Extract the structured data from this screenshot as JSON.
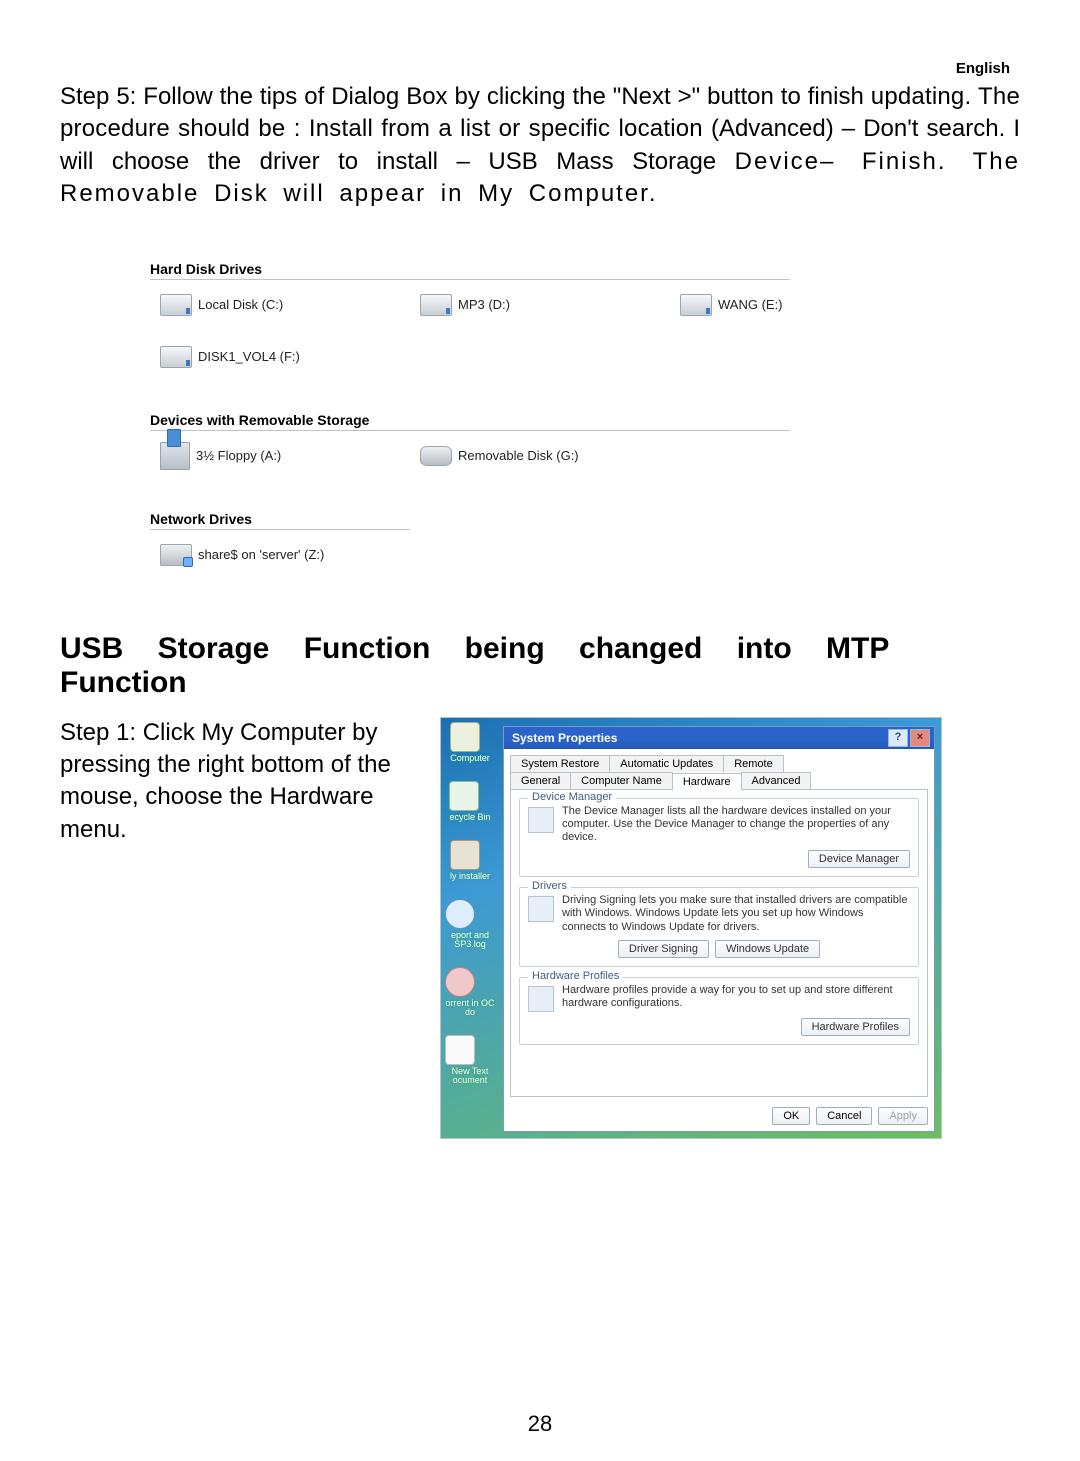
{
  "header": {
    "language": "English"
  },
  "paragraph_step5_lines": [
    "Step 5: Follow the tips of Dialog Box by clicking the \"Next >\" button to finish",
    "updating. The procedure should be : Install from a list or specific location",
    "(Advanced) – Don't search. I will choose the driver to install – USB Mass Storage",
    "Device– Finish. The Removable Disk will appear in My Computer."
  ],
  "my_computer": {
    "sections": {
      "hdd": {
        "title": "Hard Disk Drives",
        "items": [
          "Local Disk (C:)",
          "MP3 (D:)",
          "WANG (E:)",
          "DISK1_VOL4 (F:)"
        ]
      },
      "removable": {
        "title": "Devices with Removable Storage",
        "items": [
          "3½ Floppy (A:)",
          "Removable Disk (G:)"
        ]
      },
      "network": {
        "title": "Network Drives",
        "items": [
          "share$ on 'server' (Z:)"
        ]
      }
    }
  },
  "heading2": {
    "line1": "USB Storage Function being changed into MTP",
    "line2": "Function"
  },
  "step1_text": "Step 1: Click My Computer by pressing the right bottom of the mouse, choose the Hardware menu.",
  "desktop_icons": [
    "Computer",
    "ecycle Bin",
    "ly installer",
    "eport  and SP3.log",
    "orrent in OC   do",
    "New Text ocument"
  ],
  "sysprops": {
    "title": "System Properties",
    "tabs_row1": [
      "System Restore",
      "Automatic Updates",
      "Remote"
    ],
    "tabs_row2": [
      "General",
      "Computer Name",
      "Hardware",
      "Advanced"
    ],
    "selected_tab": "Hardware",
    "group1": {
      "title": "Device Manager",
      "text": "The Device Manager lists all the hardware devices installed on your computer. Use the Device Manager to change the properties of any device.",
      "button": "Device Manager"
    },
    "group2": {
      "title": "Drivers",
      "text": "Driving Signing lets you make sure that installed drivers are compatible with Windows. Windows Update lets you set up how Windows connects to Windows Update for drivers.",
      "button1": "Driver Signing",
      "button2": "Windows Update"
    },
    "group3": {
      "title": "Hardware Profiles",
      "text": "Hardware profiles provide a way for you to set up and store different hardware configurations.",
      "button": "Hardware Profiles"
    },
    "buttons": {
      "ok": "OK",
      "cancel": "Cancel",
      "apply": "Apply"
    }
  },
  "page_number": "28"
}
